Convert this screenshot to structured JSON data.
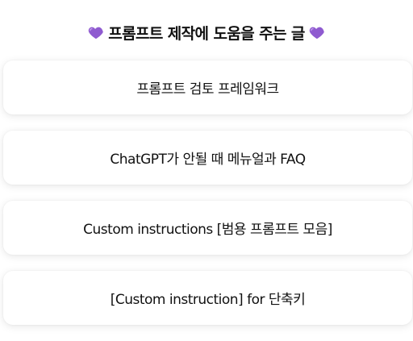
{
  "header": {
    "title": "프롬프트 제작에 도움을 주는  글",
    "left_icon": "purple-heart-icon",
    "right_icon": "purple-heart-icon",
    "heart_color": "#8f5bd0"
  },
  "links": [
    {
      "label": "프롬프트 검토 프레임워크"
    },
    {
      "label": "ChatGPT가 안될 때 메뉴얼과 FAQ"
    },
    {
      "label": "Custom instructions [범용 프롬프트 모음]"
    },
    {
      "label": "[Custom instruction] for 단축키"
    }
  ]
}
